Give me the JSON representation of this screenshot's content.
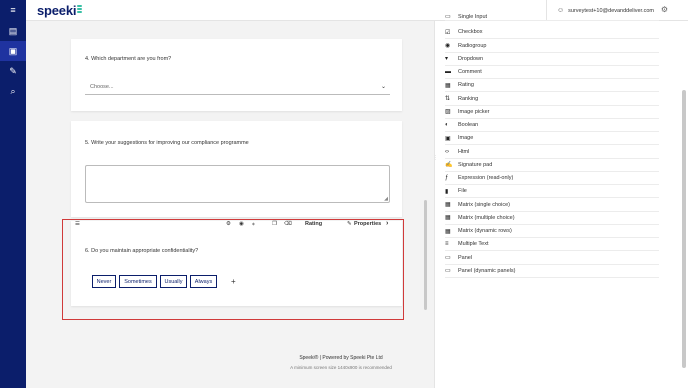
{
  "app": {
    "logo_text": "speeki"
  },
  "rail": {
    "items": [
      {
        "name": "menu-icon",
        "glyph": "≡"
      },
      {
        "name": "dashboard-icon",
        "glyph": "▤"
      },
      {
        "name": "survey-icon",
        "glyph": "▣"
      },
      {
        "name": "edit-icon",
        "glyph": "✎"
      },
      {
        "name": "search-icon",
        "glyph": "⌕"
      }
    ]
  },
  "header": {
    "user_email": "surveytest+10@devanddeliver.com",
    "user_icon": "user-icon",
    "settings_icon": "gear-icon"
  },
  "questions": {
    "q4": {
      "title": "4.  Which department are you from?",
      "dropdown_placeholder": "Choose..."
    },
    "q5": {
      "title": "5.  Write your suggestions for improving our compliance programme"
    },
    "q6": {
      "title": "6.  Do you maintain appropriate confidentiality?",
      "rating_options": [
        "Never",
        "Sometimes",
        "Usually",
        "Always"
      ],
      "add_label": "+"
    }
  },
  "question_toolbar": {
    "type_label": "Rating",
    "properties_label": "Properties",
    "properties_arrow": "›"
  },
  "toolbox": {
    "items": [
      {
        "label": "Single Input",
        "icon": "▭"
      },
      {
        "label": "Checkbox",
        "icon": "☑"
      },
      {
        "label": "Radiogroup",
        "icon": "◉"
      },
      {
        "label": "Dropdown",
        "icon": "▾"
      },
      {
        "label": "Comment",
        "icon": "▬"
      },
      {
        "label": "Rating",
        "icon": "▦"
      },
      {
        "label": "Ranking",
        "icon": "⇅"
      },
      {
        "label": "Image picker",
        "icon": "▨"
      },
      {
        "label": "Boolean",
        "icon": "◐"
      },
      {
        "label": "Image",
        "icon": "▣"
      },
      {
        "label": "Html",
        "icon": "‹›"
      },
      {
        "label": "Signature pad",
        "icon": "✍"
      },
      {
        "label": "Expression (read-only)",
        "icon": "ƒ"
      },
      {
        "label": "File",
        "icon": "▮"
      },
      {
        "label": "Matrix (single choice)",
        "icon": "▦"
      },
      {
        "label": "Matrix (multiple choice)",
        "icon": "▦"
      },
      {
        "label": "Matrix (dynamic rows)",
        "icon": "▦"
      },
      {
        "label": "Multiple Text",
        "icon": "≡"
      },
      {
        "label": "Panel",
        "icon": "▭"
      },
      {
        "label": "Panel (dynamic panels)",
        "icon": "▭"
      }
    ]
  },
  "footer": {
    "line1": "Speeki® | Powered by Speeki Pte Ltd",
    "line2": "A minimum screen size 1440x900 is recommended"
  }
}
